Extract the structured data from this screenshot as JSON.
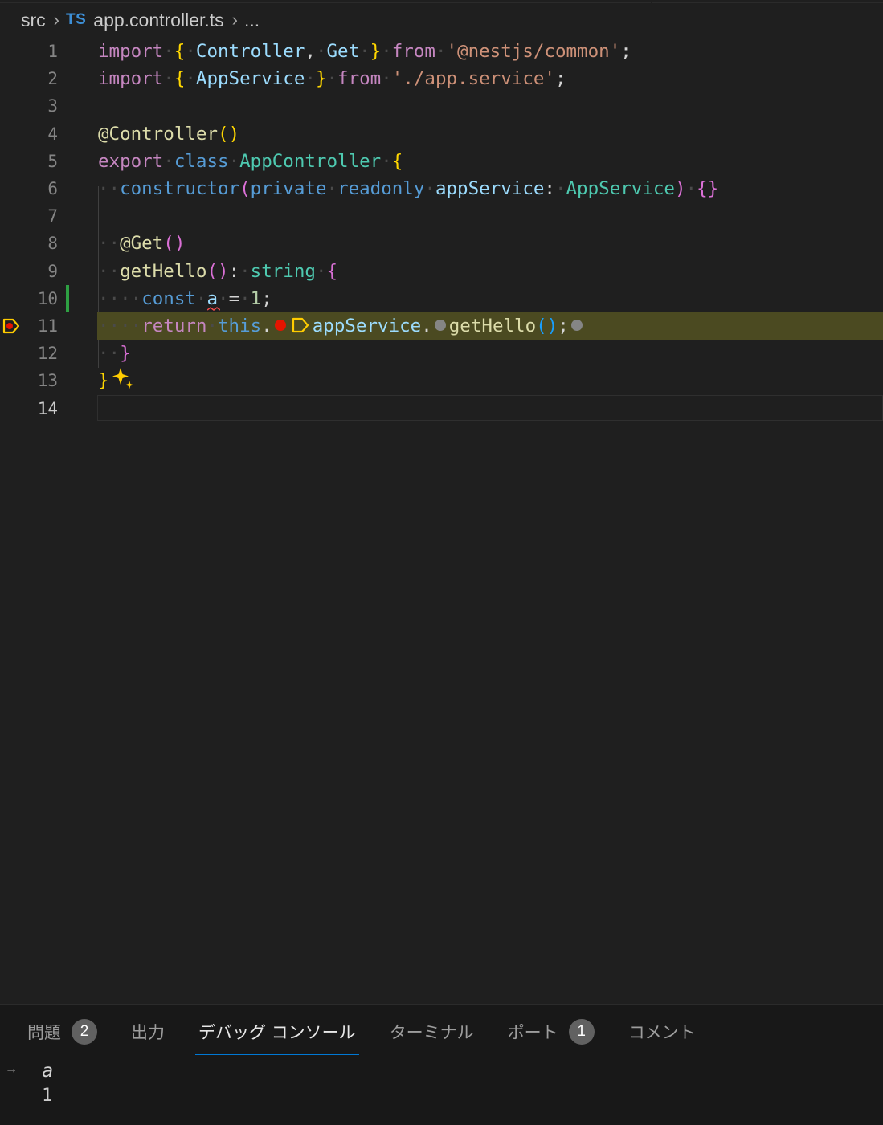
{
  "breadcrumb": {
    "folder": "src",
    "lang_badge": "TS",
    "file": "app.controller.ts",
    "more": "..."
  },
  "editor": {
    "line_numbers": [
      "1",
      "2",
      "3",
      "4",
      "5",
      "6",
      "7",
      "8",
      "9",
      "10",
      "11",
      "12",
      "13",
      "14"
    ],
    "active_line": "14",
    "paused_line": "11",
    "code": {
      "l1": [
        "import",
        "{",
        "Controller",
        ",",
        "Get",
        "}",
        "from",
        "'@nestjs/common'",
        ";"
      ],
      "l2": [
        "import",
        "{",
        "AppService",
        "}",
        "from",
        "'./app.service'",
        ";"
      ],
      "l4": [
        "@Controller",
        "(",
        ")"
      ],
      "l5": [
        "export",
        "class",
        "AppController",
        "{"
      ],
      "l6": [
        "constructor",
        "(",
        "private",
        "readonly",
        "appService",
        ":",
        "AppService",
        ")",
        "{}"
      ],
      "l8": [
        "@Get",
        "(",
        ")"
      ],
      "l9": [
        "getHello",
        "(",
        ")",
        ":",
        "string",
        "{"
      ],
      "l10": [
        "const",
        "a",
        "=",
        "1",
        ";"
      ],
      "l11": [
        "return",
        "this",
        ".",
        "appService",
        ".",
        "getHello",
        "(",
        ")",
        ";"
      ],
      "l12": [
        "}"
      ],
      "l13": [
        "}"
      ]
    }
  },
  "panel": {
    "tabs": [
      {
        "label": "問題",
        "badge": "2"
      },
      {
        "label": "出力"
      },
      {
        "label": "デバッグ コンソール"
      },
      {
        "label": "ターミナル"
      },
      {
        "label": "ポート",
        "badge": "1"
      },
      {
        "label": "コメント"
      }
    ],
    "active_tab": "デバッグ コンソール",
    "console": {
      "input": "a",
      "output": "1"
    }
  },
  "colors": {
    "background": "#1f1f1f",
    "paused_line_highlight": "#4b4a21",
    "breakpoint": "#e51400",
    "stack_frame": "#ffcc00",
    "git_added": "#2ea043",
    "active_tab_underline": "#0078d4"
  },
  "icons": {
    "breadcrumb_separator": "chevron-right-icon",
    "gutter": "debug-stackframe-breakpoint-icon",
    "inline_breakpoint": "breakpoint-icon",
    "inline_stackframe": "debug-stackframe-icon",
    "inline_inactive_breakpoint": "unverified-breakpoint-icon",
    "sparkle": "sparkle-icon",
    "console_prompt": "arrow-right-icon"
  }
}
